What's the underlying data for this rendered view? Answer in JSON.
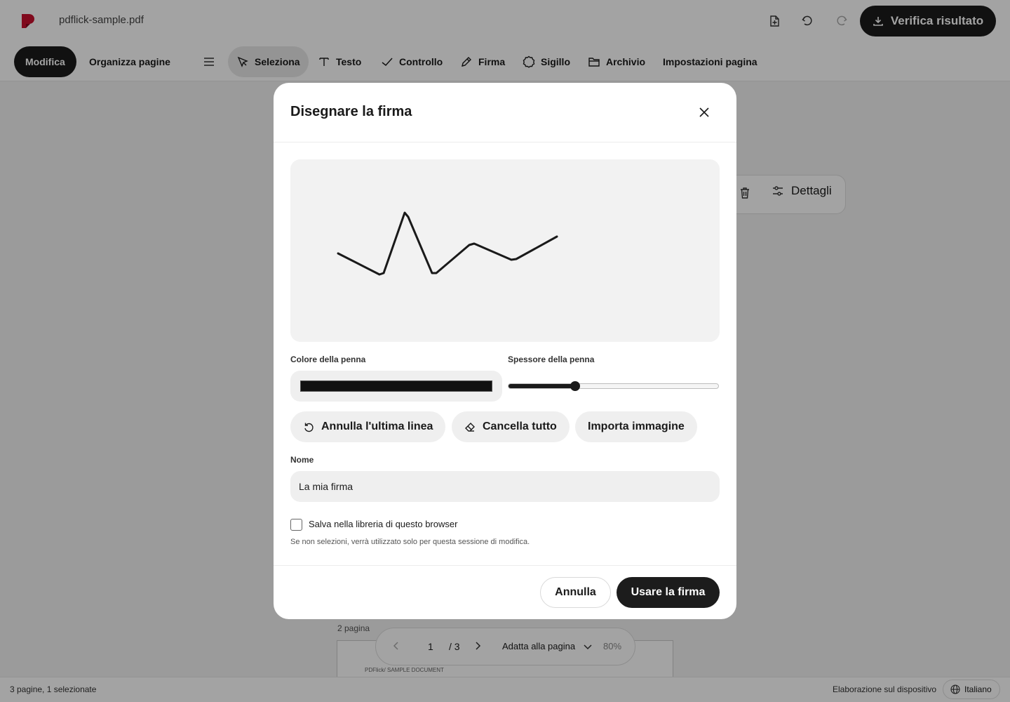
{
  "app": {
    "filename": "pdflick-sample.pdf",
    "brand_color": "#c8102e",
    "verify_label": "Verifica risultato"
  },
  "toolbar": {
    "modes": [
      {
        "label": "Modifica",
        "active": true
      },
      {
        "label": "Organizza pagine",
        "active": false
      }
    ],
    "tools": [
      {
        "label": "Seleziona",
        "icon": "cursor-icon",
        "active": true
      },
      {
        "label": "Testo",
        "icon": "text-icon"
      },
      {
        "label": "Controllo",
        "icon": "check-icon"
      },
      {
        "label": "Firma",
        "icon": "pen-icon"
      },
      {
        "label": "Sigillo",
        "icon": "seal-icon"
      },
      {
        "label": "Archivio",
        "icon": "folder-icon"
      },
      {
        "label": "Impostazioni pagina",
        "icon": null
      }
    ]
  },
  "workspace": {
    "details_label": "Dettagli",
    "page_label": "2 pagina",
    "page_thumb_text": "PDFlick/ SAMPLE DOCUMENT"
  },
  "pager": {
    "current": "1",
    "total": "/ 3",
    "fit_label": "Adatta alla pagina",
    "zoom": "80%"
  },
  "statusbar": {
    "left": "3 pagine, 1 selezionate",
    "processing": "Elaborazione sul dispositivo",
    "language": "Italiano"
  },
  "modal": {
    "title": "Disegnare la firma",
    "signature_stroke": {
      "color": "#1a1a1a",
      "points": [
        [
          68,
          134
        ],
        [
          127,
          164
        ],
        [
          133,
          162
        ],
        [
          163,
          76
        ],
        [
          168,
          82
        ],
        [
          202,
          162
        ],
        [
          208,
          162
        ],
        [
          255,
          122
        ],
        [
          262,
          120
        ],
        [
          315,
          143
        ],
        [
          322,
          142
        ],
        [
          380,
          110
        ]
      ]
    },
    "pen_color_label": "Colore della penna",
    "pen_color": "#111111",
    "pen_width_label": "Spessore della penna",
    "pen_width_fraction": 0.31,
    "actions": {
      "undo_label": "Annulla l'ultima linea",
      "clear_label": "Cancella tutto",
      "import_label": "Importa immagine"
    },
    "name_label": "Nome",
    "name_value": "La mia firma",
    "save_label": "Salva nella libreria di questo browser",
    "save_checked": false,
    "hint": "Se non selezioni, verrà utilizzato solo per questa sessione di modifica.",
    "cancel_label": "Annulla",
    "use_label": "Usare la firma"
  }
}
